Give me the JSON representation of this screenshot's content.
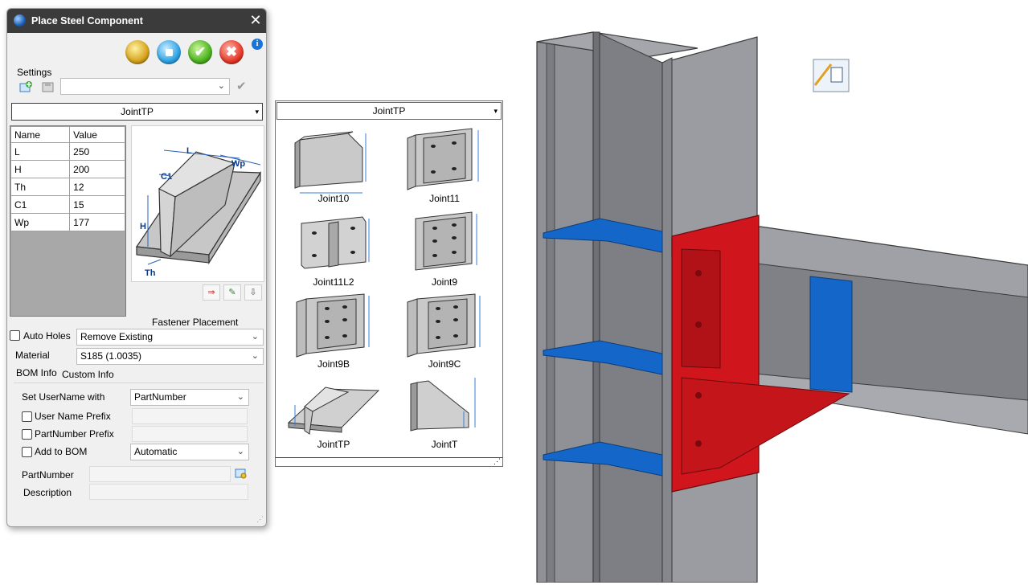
{
  "dialog": {
    "title": "Place Steel Component",
    "close_glyph": "✕",
    "settings_label": "Settings",
    "settings_value": "",
    "joint_selected": "JointTP",
    "params_header": {
      "name": "Name",
      "value": "Value"
    },
    "params": [
      {
        "name": "L",
        "value": "250"
      },
      {
        "name": "H",
        "value": "200"
      },
      {
        "name": "Th",
        "value": "12"
      },
      {
        "name": "C1",
        "value": "15"
      },
      {
        "name": "Wp",
        "value": "177"
      }
    ],
    "preview_dims": {
      "L": "L",
      "Wp": "Wp",
      "C1": "C1",
      "H": "H",
      "Th": "Th"
    },
    "fastener_placement_label": "Fastener Placement",
    "auto_holes_label": "Auto Holes",
    "auto_holes_value": "Remove Existing",
    "material_label": "Material",
    "material_value": "S185  (1.0035)",
    "tabs": [
      "BOM Info",
      "Custom Info"
    ],
    "set_username_label": "Set UserName with",
    "set_username_value": "PartNumber",
    "username_prefix_label": "User Name Prefix",
    "partnumber_prefix_label": "PartNumber Prefix",
    "add_to_bom_label": "Add to BOM",
    "add_to_bom_value": "Automatic",
    "partnumber_label": "PartNumber",
    "description_label": "Description"
  },
  "joint_panel": {
    "selected": "JointTP",
    "items": [
      "Joint10",
      "Joint11",
      "Joint11L2",
      "Joint9",
      "Joint9B",
      "Joint9C",
      "JointTP",
      "JointT"
    ]
  },
  "colors": {
    "steel": "#8d8f94",
    "plate_red": "#d0161c",
    "stiffener_blue": "#1467c8",
    "titlebar": "#3b3b3b"
  }
}
